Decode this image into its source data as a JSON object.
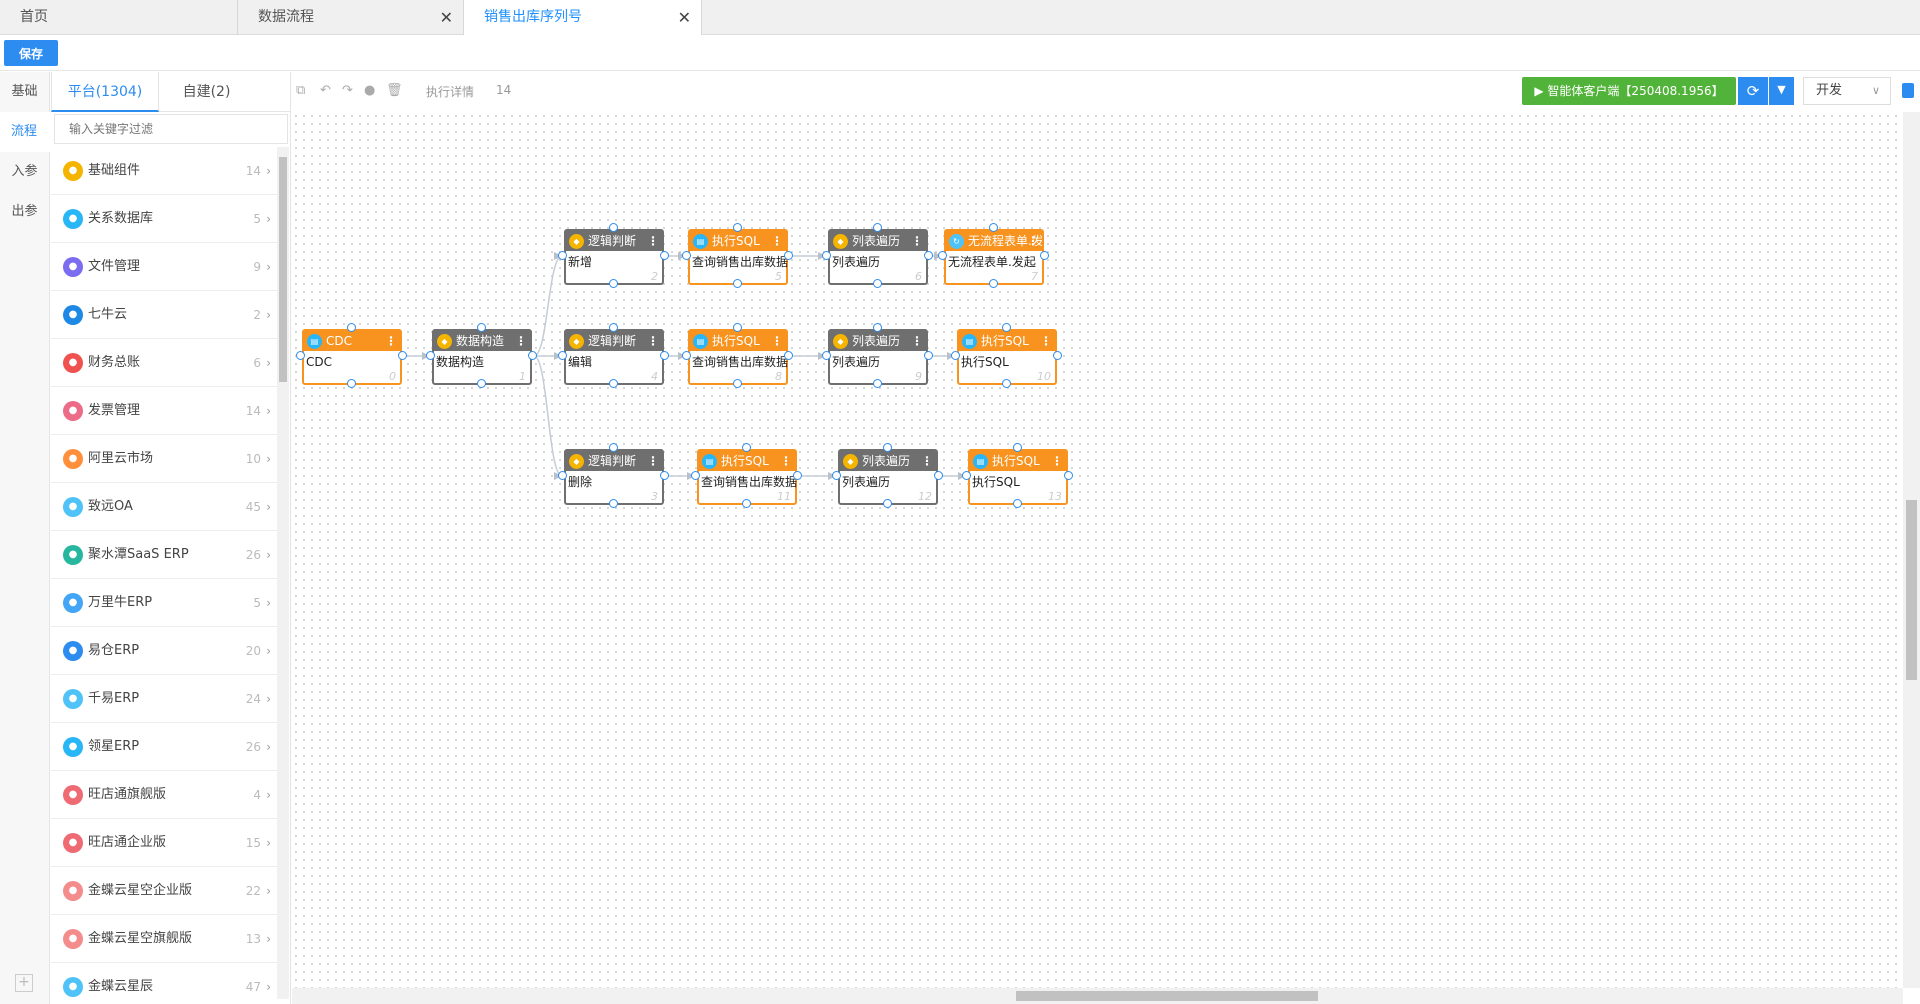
{
  "tabs": [
    {
      "label": "首页",
      "active": false,
      "closable": false
    },
    {
      "label": "数据流程",
      "active": false,
      "closable": true
    },
    {
      "label": "销售出库序列号",
      "active": true,
      "closable": true
    }
  ],
  "toolbar_top": {
    "save_label": "保存"
  },
  "left_tabs": [
    "基础",
    "流程",
    "入参",
    "出参"
  ],
  "left_tabs_active": "流程",
  "catalog": {
    "tabs": [
      {
        "label": "平台(1304)",
        "active": true
      },
      {
        "label": "自建(2)",
        "active": false
      }
    ],
    "filter_placeholder": "输入关键字过滤",
    "items": [
      {
        "name": "基础组件",
        "count": "14",
        "color": "#f5b400"
      },
      {
        "name": "关系数据库",
        "count": "5",
        "color": "#29b6f6"
      },
      {
        "name": "文件管理",
        "count": "9",
        "color": "#7c6cf0"
      },
      {
        "name": "七牛云",
        "count": "2",
        "color": "#1e88e5"
      },
      {
        "name": "财务总账",
        "count": "6",
        "color": "#ef5350"
      },
      {
        "name": "发票管理",
        "count": "14",
        "color": "#ec6b86"
      },
      {
        "name": "阿里云市场",
        "count": "10",
        "color": "#ff8f3a"
      },
      {
        "name": "致远OA",
        "count": "45",
        "color": "#4fc3f7"
      },
      {
        "name": "聚水潭SaaS ERP",
        "count": "26",
        "color": "#26b79e"
      },
      {
        "name": "万里牛ERP",
        "count": "5",
        "color": "#42a5f5"
      },
      {
        "name": "易仓ERP",
        "count": "20",
        "color": "#2d8cf0"
      },
      {
        "name": "千易ERP",
        "count": "24",
        "color": "#4fc3f7"
      },
      {
        "name": "领星ERP",
        "count": "26",
        "color": "#29b6f6"
      },
      {
        "name": "旺店通旗舰版",
        "count": "4",
        "color": "#ef6b73"
      },
      {
        "name": "旺店通企业版",
        "count": "15",
        "color": "#ef6b73"
      },
      {
        "name": "金蝶云星空企业版",
        "count": "22",
        "color": "#f48c8c"
      },
      {
        "name": "金蝶云星空旗舰版",
        "count": "13",
        "color": "#f48c8c"
      },
      {
        "name": "金蝶云星辰",
        "count": "47",
        "color": "#4fc3f7"
      }
    ]
  },
  "canvas_toolbar": {
    "detail_label": "执行详情",
    "count": "14",
    "agent_label": "▶ 智能体客户端【250408.1956】",
    "env_select": "开发"
  },
  "flow": {
    "nodes": [
      {
        "id": "n1",
        "title": "CDC",
        "body": "CDC",
        "num": "0",
        "style": "orange",
        "icon": "db"
      },
      {
        "id": "n2",
        "title": "数据构造",
        "body": "数据构造",
        "num": "1",
        "style": "gray",
        "icon": "lay"
      },
      {
        "id": "n3",
        "title": "逻辑判断",
        "body": "新增",
        "num": "2",
        "style": "gray",
        "icon": "lay"
      },
      {
        "id": "n4",
        "title": "执行SQL",
        "body": "查询销售出库数据",
        "num": "5",
        "style": "orange",
        "icon": "db"
      },
      {
        "id": "n5",
        "title": "列表遍历",
        "body": "列表遍历",
        "num": "6",
        "style": "gray",
        "icon": "lay"
      },
      {
        "id": "n6",
        "title": "无流程表单.发起",
        "body": "无流程表单.发起",
        "num": "7",
        "style": "orange",
        "icon": "flow"
      },
      {
        "id": "n7",
        "title": "逻辑判断",
        "body": "编辑",
        "num": "4",
        "style": "gray",
        "icon": "lay"
      },
      {
        "id": "n8",
        "title": "执行SQL",
        "body": "查询销售出库数据",
        "num": "8",
        "style": "orange",
        "icon": "db"
      },
      {
        "id": "n9",
        "title": "列表遍历",
        "body": "列表遍历",
        "num": "9",
        "style": "gray",
        "icon": "lay"
      },
      {
        "id": "n10",
        "title": "执行SQL",
        "body": "执行SQL",
        "num": "10",
        "style": "orange",
        "icon": "db"
      },
      {
        "id": "n11",
        "title": "逻辑判断",
        "body": "删除",
        "num": "3",
        "style": "gray",
        "icon": "lay"
      },
      {
        "id": "n12",
        "title": "执行SQL",
        "body": "查询销售出库数据",
        "num": "11",
        "style": "orange",
        "icon": "db"
      },
      {
        "id": "n13",
        "title": "列表遍历",
        "body": "列表遍历",
        "num": "12",
        "style": "gray",
        "icon": "lay"
      },
      {
        "id": "n14",
        "title": "执行SQL",
        "body": "执行SQL",
        "num": "13",
        "style": "orange",
        "icon": "db"
      }
    ],
    "edges": [
      [
        "n1",
        "n2"
      ],
      [
        "n2",
        "n3"
      ],
      [
        "n2",
        "n7"
      ],
      [
        "n2",
        "n11"
      ],
      [
        "n3",
        "n4"
      ],
      [
        "n4",
        "n5"
      ],
      [
        "n5",
        "n6"
      ],
      [
        "n7",
        "n8"
      ],
      [
        "n8",
        "n9"
      ],
      [
        "n9",
        "n10"
      ],
      [
        "n11",
        "n12"
      ],
      [
        "n12",
        "n13"
      ],
      [
        "n13",
        "n14"
      ]
    ]
  },
  "colors": {
    "accent": "#2d8cf0",
    "node_orange": "#f7931e",
    "node_gray": "#6f6f6f",
    "agent_green": "#52b33a"
  }
}
